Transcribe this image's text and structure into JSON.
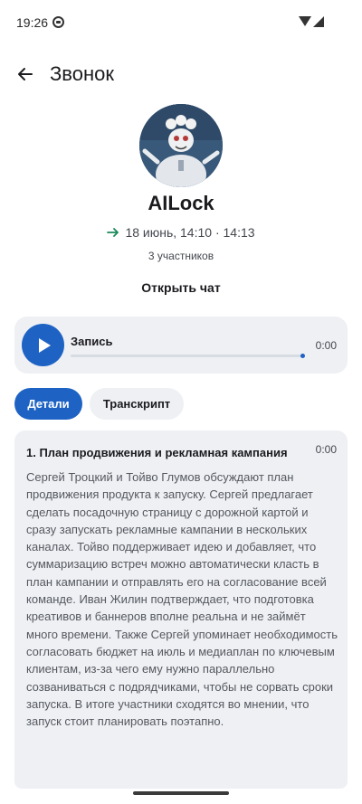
{
  "status_bar": {
    "time": "19:26",
    "app_icon": "notification-icon",
    "wifi_icon": "wifi-icon",
    "signal_icon": "signal-icon"
  },
  "header": {
    "title": "Звонок",
    "back_icon": "arrow-back-icon"
  },
  "call": {
    "name": "AILock",
    "direction_icon": "arrow-right-icon",
    "datetime": "18 июнь, 14:10 · 14:13",
    "participants": "3 участников",
    "open_chat_label": "Открыть чат"
  },
  "player": {
    "label": "Запись",
    "time": "0:00",
    "progress": 0.995
  },
  "tabs": [
    {
      "label": "Детали",
      "active": true
    },
    {
      "label": "Транскрипт",
      "active": false
    }
  ],
  "summary": {
    "title": "1. План продвижения и рекламная кампания",
    "time": "0:00",
    "text": "Сергей Троцкий и Тойво Глумов обсуждают план продвижения продукта к запуску. Сергей предлагает сделать посадочную страницу с дорожной картой и сразу запускать рекламные кампании в нескольких каналах. Тойво поддерживает идею и добавляет, что суммаризацию встреч можно автоматически класть в план кампании и отправлять его на согласование всей команде. Иван Жилин подтверждает, что подготовка креативов и баннеров вполне реальна и не займёт много времени. Также Сергей упоминает необходимость согласовать бюджет на июль и медиаплан по ключевым клиентам, из-за чего ему нужно параллельно созваниваться с подрядчиками, чтобы не сорвать сроки запуска. В итоге участники сходятся во мнении, что запуск стоит планировать поэтапно."
  },
  "colors": {
    "accent": "#1e63c4",
    "card": "#eef0f4",
    "direction_arrow": "#1a8a5a"
  }
}
